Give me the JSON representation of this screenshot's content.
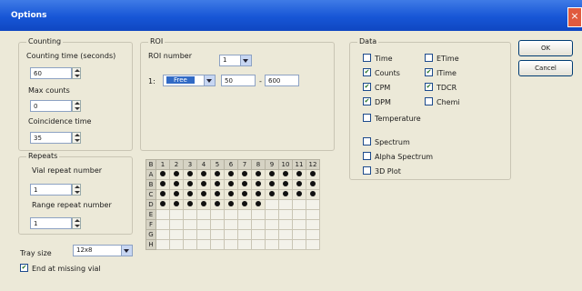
{
  "window": {
    "title": "Options",
    "close_glyph": "×"
  },
  "buttons": {
    "ok": "OK",
    "cancel": "Cancel"
  },
  "counting": {
    "title": "Counting",
    "time_label": "Counting time (seconds)",
    "time_value": "60",
    "max_label": "Max counts",
    "max_value": "0",
    "coinc_label": "Coincidence time",
    "coinc_value": "35"
  },
  "roi": {
    "title": "ROI",
    "number_label": "ROI number",
    "number_value": "1",
    "row_label": "1:",
    "nuclide_value": "Free",
    "low_value": "50",
    "dash": "-",
    "high_value": "600"
  },
  "data": {
    "title": "Data",
    "items": [
      {
        "label": "Time",
        "checked": false
      },
      {
        "label": "Counts",
        "checked": true
      },
      {
        "label": "CPM",
        "checked": true
      },
      {
        "label": "DPM",
        "checked": true
      },
      {
        "label": "Temperature",
        "checked": false
      },
      {
        "label": "ETime",
        "checked": false
      },
      {
        "label": "ITime",
        "checked": true
      },
      {
        "label": "TDCR",
        "checked": true
      },
      {
        "label": "Chemi",
        "checked": false
      },
      {
        "label": "Spectrum",
        "checked": false
      },
      {
        "label": "Alpha Spectrum",
        "checked": false
      },
      {
        "label": "3D Plot",
        "checked": false
      }
    ]
  },
  "repeats": {
    "title": "Repeats",
    "vial_label": "Vial repeat number",
    "vial_value": "1",
    "range_label": "Range repeat number",
    "range_value": "1"
  },
  "tray": {
    "size_label": "Tray size",
    "size_value": "12x8",
    "end_label": "End at missing vial",
    "end_checked": true
  },
  "grid": {
    "corner": "B",
    "columns": [
      "1",
      "2",
      "3",
      "4",
      "5",
      "6",
      "7",
      "8",
      "9",
      "10",
      "11",
      "12"
    ],
    "rows": [
      "A",
      "B",
      "C",
      "D",
      "E",
      "F",
      "G",
      "H"
    ],
    "filled_counts": [
      12,
      12,
      12,
      8,
      0,
      0,
      0,
      0
    ]
  }
}
